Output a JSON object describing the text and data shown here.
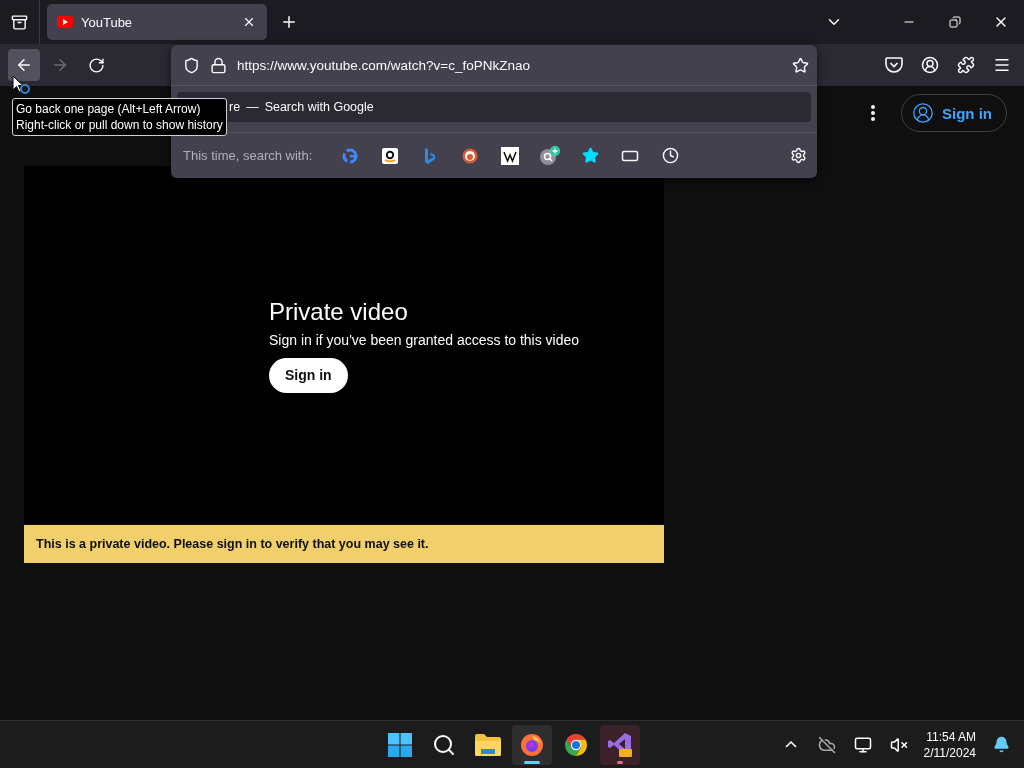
{
  "tabs": [
    {
      "title": "YouTube",
      "selected": true
    }
  ],
  "toolbar": {
    "back_hovered": true,
    "forward_disabled": true
  },
  "address_bar": {
    "url": "https://www.youtube.com/watch?v=c_foPNkZnao",
    "suggestion": {
      "query": "re",
      "separator": "—",
      "action": "Search with Google"
    },
    "search_with_label": "This time, search with:",
    "engines": [
      {
        "kind": "google"
      },
      {
        "kind": "amazon"
      },
      {
        "kind": "bing"
      },
      {
        "kind": "duckduckgo"
      },
      {
        "kind": "wikipedia"
      },
      {
        "kind": "add-search"
      },
      {
        "kind": "bookmarks"
      },
      {
        "kind": "tabs"
      },
      {
        "kind": "history"
      }
    ]
  },
  "tooltip": {
    "lines": [
      "Go back one page (Alt+Left Arrow)",
      "Right-click or pull down to show history"
    ]
  },
  "page": {
    "sign_in": "Sign in",
    "player": {
      "title": "Private video",
      "message": "Sign in if you've been granted access to this video",
      "button": "Sign in"
    },
    "banner": "This is a private video. Please sign in to verify that you may see it."
  },
  "taskbar": {
    "apps": [
      {
        "kind": "start",
        "selected": false,
        "running": false
      },
      {
        "kind": "search",
        "selected": false,
        "running": false
      },
      {
        "kind": "explorer",
        "selected": false,
        "running": false
      },
      {
        "kind": "firefox",
        "selected": true,
        "running": true
      },
      {
        "kind": "chrome",
        "selected": false,
        "running": false
      },
      {
        "kind": "visualstudio",
        "selected": false,
        "running": true
      }
    ],
    "time": "11:54 AM",
    "date": "2/11/2024"
  }
}
